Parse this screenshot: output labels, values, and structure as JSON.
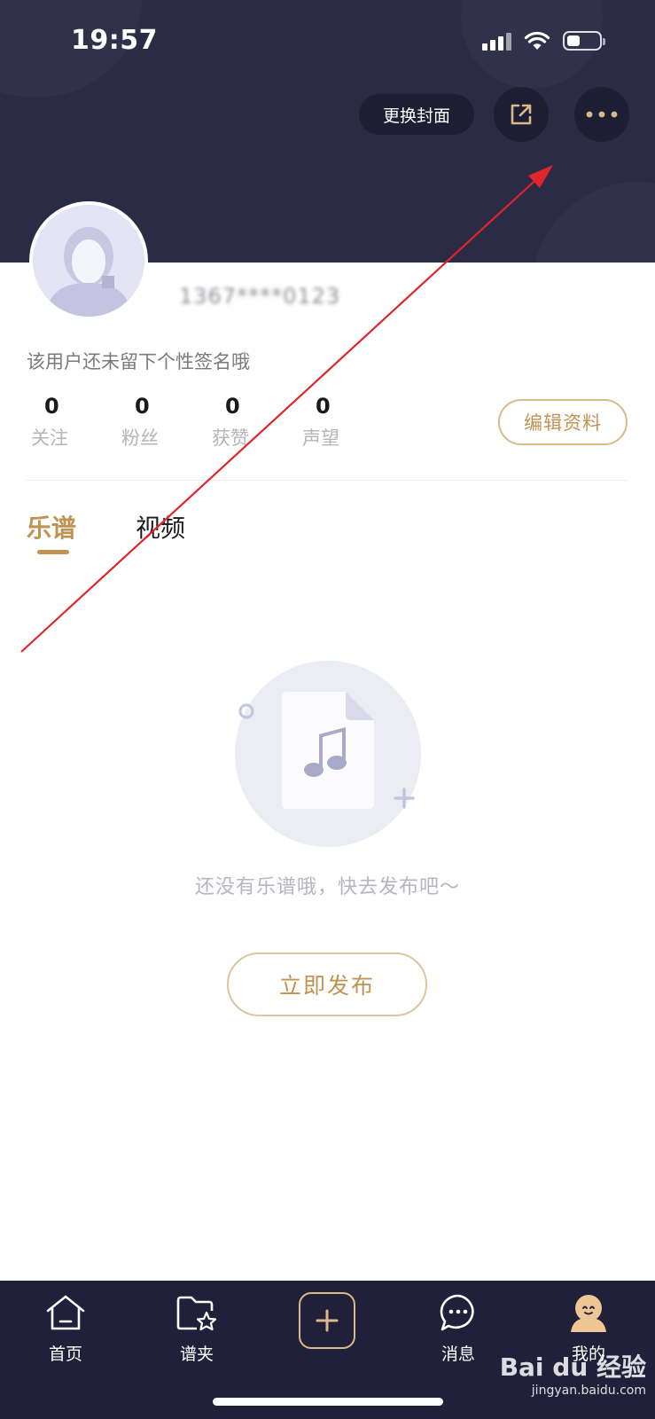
{
  "status_bar": {
    "time": "19:57"
  },
  "header": {
    "change_cover_label": "更换封面",
    "share_icon": "share-external-icon",
    "more_icon": "more-dots-icon"
  },
  "profile": {
    "username": "1367****0123",
    "signature": "该用户还未留下个性签名哦",
    "stats": [
      {
        "value": "0",
        "label": "关注"
      },
      {
        "value": "0",
        "label": "粉丝"
      },
      {
        "value": "0",
        "label": "获赞"
      },
      {
        "value": "0",
        "label": "声望"
      }
    ],
    "edit_label": "编辑资料"
  },
  "content_tabs": [
    {
      "label": "乐谱",
      "active": true
    },
    {
      "label": "视频",
      "active": false
    }
  ],
  "empty_state": {
    "message": "还没有乐谱哦，快去发布吧～",
    "publish_label": "立即发布"
  },
  "bottom_nav": [
    {
      "label": "首页",
      "icon": "home-icon"
    },
    {
      "label": "谱夹",
      "icon": "folder-star-icon"
    },
    {
      "label": "",
      "icon": "add-icon"
    },
    {
      "label": "消息",
      "icon": "chat-bubble-icon"
    },
    {
      "label": "我的",
      "icon": "profile-icon",
      "active": true
    }
  ],
  "watermark": {
    "brand": "Bai du 经验",
    "url": "jingyan.baidu.com"
  },
  "colors": {
    "header_bg": "#2b2b46",
    "accent": "#c19353",
    "tabbar_bg": "#20203a",
    "annotation_arrow": "#e0262a"
  }
}
